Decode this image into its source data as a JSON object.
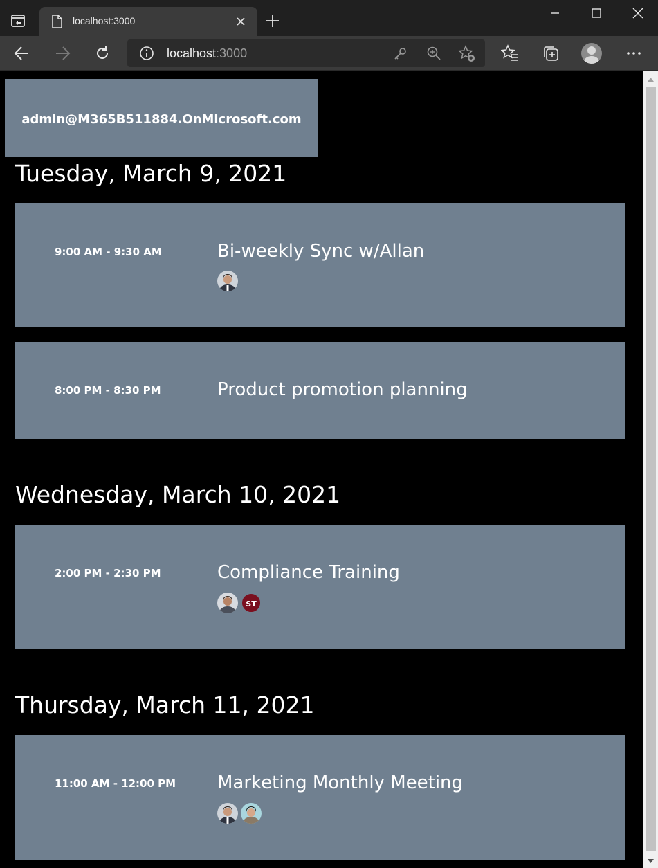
{
  "browser": {
    "tab_title": "localhost:3000",
    "url_host": "localhost",
    "url_port": ":3000",
    "icons": [
      "tab-actions-icon",
      "page-icon",
      "close-icon",
      "plus-icon",
      "minimize-icon",
      "maximize-icon",
      "close-window-icon",
      "back-arrow-icon",
      "forward-arrow-icon",
      "refresh-icon",
      "info-icon",
      "key-icon",
      "zoom-icon",
      "add-favorite-icon",
      "favorites-icon",
      "collections-icon",
      "profile-icon",
      "more-icon"
    ]
  },
  "user": {
    "email": "admin@M365B511884.OnMicrosoft.com"
  },
  "days": [
    {
      "heading": "Tuesday, March 9, 2021",
      "events": [
        {
          "time": "9:00 AM - 9:30 AM",
          "title": "Bi-weekly Sync w/Allan",
          "attendees": [
            "photo-man"
          ]
        },
        {
          "time": "8:00 PM - 8:30 PM",
          "title": "Product promotion planning",
          "attendees": []
        }
      ]
    },
    {
      "heading": "Wednesday, March 10, 2021",
      "events": [
        {
          "time": "2:00 PM - 2:30 PM",
          "title": "Compliance Training",
          "attendees": [
            "photo-man2",
            "ST"
          ]
        }
      ]
    },
    {
      "heading": "Thursday, March 11, 2021",
      "events": [
        {
          "time": "11:00 AM - 12:00 PM",
          "title": "Marketing Monthly Meeting",
          "attendees": [
            "photo-man",
            "photo-woman"
          ]
        }
      ]
    }
  ],
  "colors": {
    "card": "#708090",
    "page_bg": "#000000",
    "initials_avatar": "#7a0f1f"
  }
}
